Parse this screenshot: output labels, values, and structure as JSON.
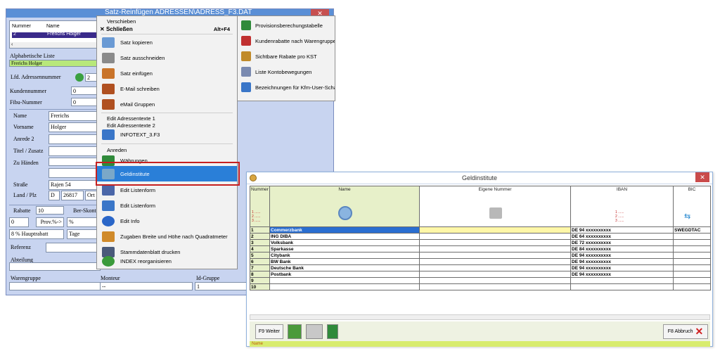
{
  "bg_window": {
    "title": "Satz-Reinfügen   ADRESSEN\\ADRESS_F3.DAT",
    "list_headers": [
      "Nummer",
      "Name"
    ],
    "list_row": {
      "nummer": "2",
      "name": "Frerichs Holger"
    },
    "alpha_label": "Alphabetische Liste",
    "alpha_value": "Frerichs Holger",
    "lfd_label": "Lfd. Adressennummer",
    "lfd_value": "2",
    "kunden_label": "Kundennummer",
    "kunden_value": "0",
    "fibu_label": "Fibu-Nummer",
    "fibu_value": "0",
    "name_label": "Name",
    "name_value": "Frerichs",
    "vorname_label": "Vorname",
    "vorname_value": "Holger",
    "anrede2_label": "Anrede 2",
    "titel_label": "Titel / Zusatz",
    "zuhanden_label": "Zu Händen",
    "strasse_label": "Straße",
    "strasse_value": "Rajen 54",
    "land_label": "Land / Plz",
    "land_value": "D",
    "plz_value": "26817",
    "ort_label": "Ort",
    "rabatte_label": "Rabatte",
    "rabatte_value": "10",
    "berskonto_label": "Ber-Skonto",
    "rab_small": "0",
    "prov_label": "Prov.%->",
    "pct_label": "%",
    "hauptrabatt": "8 % Hauptrabatt",
    "tage_label": "Tage",
    "referenz_label": "Referenz",
    "abteilung_label": "Abteilung",
    "warengruppe_label": "Warengruppe",
    "monteur_label": "Monteur",
    "monteur_value": "--",
    "idgruppe_label": "Id-Gruppe",
    "idgruppe_value": "1"
  },
  "context_menu": {
    "top_item": "Verschieben",
    "close_label": "Schließen",
    "close_shortcut": "Alt+F4",
    "items": [
      {
        "label": "Satz kopieren",
        "icon": "copy-icon",
        "color": "#6a9ad4"
      },
      {
        "label": "Satz ausschneiden",
        "icon": "scissors-icon",
        "color": "#8a8a8a"
      },
      {
        "label": "Satz einfügen",
        "icon": "paste-icon",
        "color": "#c9742a"
      },
      {
        "label": "E-Mail schreiben",
        "icon": "email-icon",
        "color": "#b05020"
      },
      {
        "label": "eMail Gruppen",
        "icon": "email-groups-icon",
        "color": "#b05020"
      }
    ],
    "text_items": [
      "Edit Adressentexte 1",
      "Edit Adressentexte 2"
    ],
    "infotext": "INFOTEXT_3.F3",
    "anreden": "Anreden",
    "items2": [
      {
        "label": "Währungen",
        "icon": "currency-icon",
        "color": "#2f8a3a"
      },
      {
        "label": "Geldinstitute",
        "icon": "bank-icon",
        "color": "#7aa8c8"
      },
      {
        "label": "Edit Listenform",
        "icon": "list-edit-icon",
        "color": "#4a66a8"
      },
      {
        "label": "Edit Listenform",
        "icon": "list-form-icon",
        "color": "#3a76c8"
      },
      {
        "label": "Edit Info",
        "icon": "info-icon",
        "color": "#2a66c8"
      },
      {
        "label": "Zugaben Breite und Höhe nach Quadratmeter",
        "icon": "zugaben-icon",
        "color": "#d08a2a"
      },
      {
        "label": "Stammdatenblatt drucken",
        "icon": "print-icon",
        "color": "#4a5a7a"
      },
      {
        "label": "INDEX reorganisieren",
        "icon": "index-icon",
        "color": "#3a9a3a"
      }
    ]
  },
  "submenu": {
    "items": [
      {
        "label": "Provisionsberechungstabelle",
        "icon": "table-icon",
        "color": "#2f8a3a"
      },
      {
        "label": "Kundenrabatte nach Warengruppen",
        "icon": "discount-icon",
        "color": "#c03030"
      },
      {
        "label": "Sichtbare Rabate pro KST",
        "icon": "rabate-icon",
        "color": "#c08a2a"
      },
      {
        "label": "Liste Kontobewegungen",
        "icon": "konto-icon",
        "color": "#7a8ab0"
      },
      {
        "label": "Bezeichnungen für Kfm-User-Schal",
        "icon": "labels-icon",
        "color": "#3a76c8"
      }
    ]
  },
  "geldinstitute": {
    "title": "Geldinstitute",
    "headers": {
      "nummer": "Nummer",
      "name": "Name",
      "eigene": "Eigene Nummer",
      "iban": "IBAN",
      "bic": "BIC"
    },
    "filter_marks": [
      "1 ......",
      "2 ......",
      "3 ......"
    ],
    "rows": [
      {
        "nr": "1",
        "name": "Commerzbank",
        "eigene": "",
        "iban": "DE 94 xxxxxxxxxx",
        "bic": "SWEGDTAC"
      },
      {
        "nr": "2",
        "name": "ING DIBA",
        "eigene": "",
        "iban": "DE 64 xxxxxxxxxx",
        "bic": ""
      },
      {
        "nr": "3",
        "name": "Volksbank",
        "eigene": "",
        "iban": "DE 72 xxxxxxxxxx",
        "bic": ""
      },
      {
        "nr": "4",
        "name": "Sparkasse",
        "eigene": "",
        "iban": "DE 84 xxxxxxxxxx",
        "bic": ""
      },
      {
        "nr": "5",
        "name": "Citybank",
        "eigene": "",
        "iban": "DE 94 xxxxxxxxxx",
        "bic": ""
      },
      {
        "nr": "6",
        "name": "BW Bank",
        "eigene": "",
        "iban": "DE 94 xxxxxxxxxx",
        "bic": ""
      },
      {
        "nr": "7",
        "name": "Deutsche Bank",
        "eigene": "",
        "iban": "DE 94 xxxxxxxxxx",
        "bic": ""
      },
      {
        "nr": "8",
        "name": "Postbank",
        "eigene": "",
        "iban": "DE 94 xxxxxxxxxx",
        "bic": ""
      },
      {
        "nr": "9",
        "name": "",
        "eigene": "",
        "iban": "",
        "bic": ""
      },
      {
        "nr": "10",
        "name": "",
        "eigene": "",
        "iban": "",
        "bic": ""
      }
    ],
    "f9_label": "F9 Weiter",
    "f8_label": "F8 Abbruch",
    "status_field": "Name"
  }
}
